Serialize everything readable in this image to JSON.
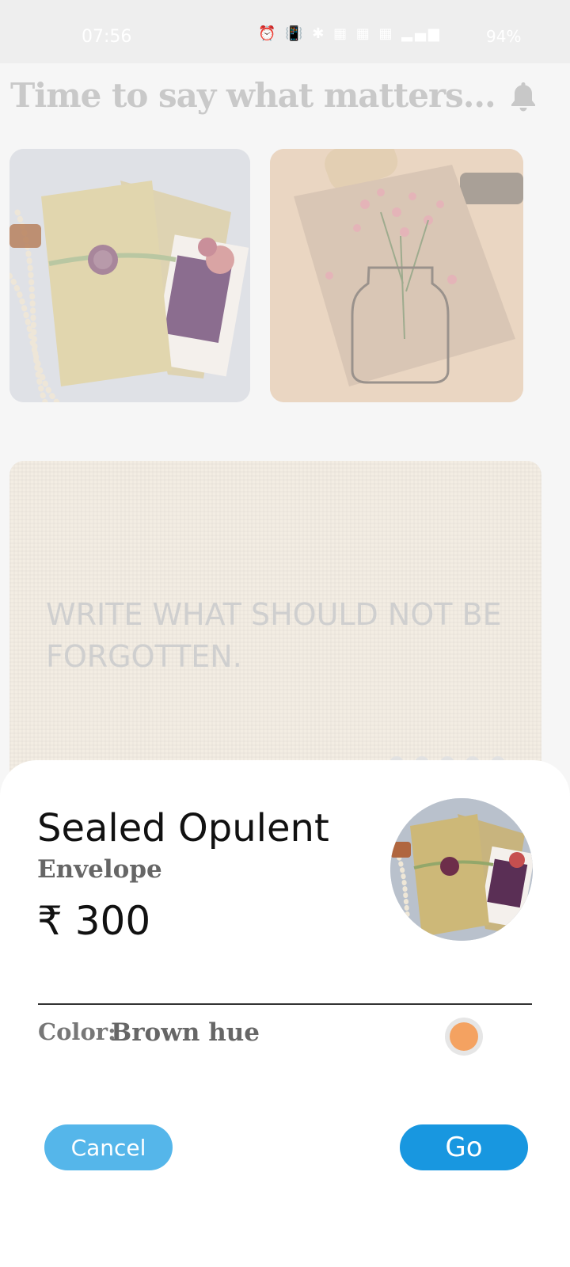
{
  "status_bar": {
    "time": "07:56",
    "icons_text": "⏰ 📳 ✱ ▦ ▦ ▦ ▂▄▆",
    "battery": "94%"
  },
  "header": {
    "title": "Time to say what matters..."
  },
  "banner": {
    "text": "WRITE WHAT SHOULD NOT BE FORGOTTEN.",
    "page_dots": 5
  },
  "product_sheet": {
    "name": "Sealed Opulent",
    "type": "Envelope",
    "price": "₹ 300",
    "color_label": "Color:",
    "color_value": "Brown hue",
    "swatch_color": "#f4a261",
    "cancel_label": "Cancel",
    "go_label": "Go"
  },
  "colors": {
    "primary_button": "#1897e0",
    "secondary_button": "#55b6ea"
  }
}
